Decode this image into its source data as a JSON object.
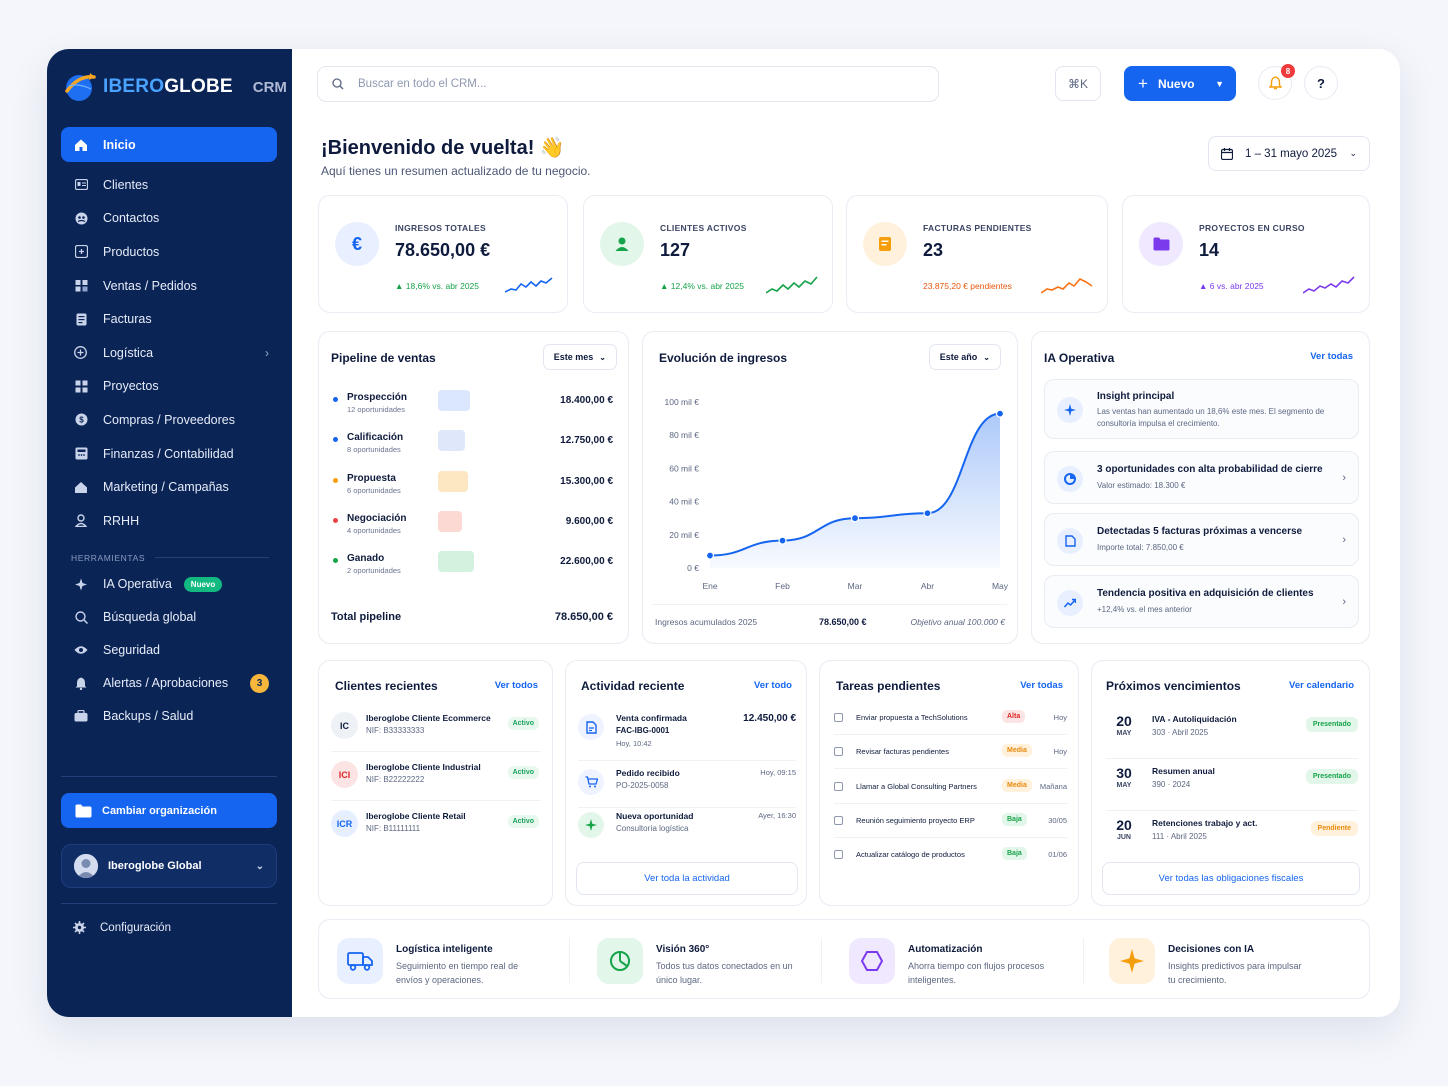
{
  "brand": {
    "name_part1": "IBERO",
    "name_part2": "GLOBE",
    "suffix": "CRM"
  },
  "sidebar": {
    "items": [
      {
        "label": "Inicio",
        "icon": "home-icon"
      },
      {
        "label": "Clientes",
        "icon": "id-card-icon"
      },
      {
        "label": "Contactos",
        "icon": "contacts-icon"
      },
      {
        "label": "Productos",
        "icon": "box-icon"
      },
      {
        "label": "Ventas / Pedidos",
        "icon": "cart-icon"
      },
      {
        "label": "Facturas",
        "icon": "invoice-icon"
      },
      {
        "label": "Logística",
        "icon": "truck-icon"
      },
      {
        "label": "Proyectos",
        "icon": "grid-icon"
      },
      {
        "label": "Compras / Proveedores",
        "icon": "coins-icon"
      },
      {
        "label": "Finanzas / Contabilidad",
        "icon": "calculator-icon"
      },
      {
        "label": "Marketing / Campañas",
        "icon": "megaphone-icon"
      },
      {
        "label": "RRHH",
        "icon": "user-icon"
      }
    ],
    "tools_header": "HERRAMIENTAS",
    "tools": [
      {
        "label": "IA Operativa",
        "badge": "Nuevo"
      },
      {
        "label": "Búsqueda global"
      },
      {
        "label": "Seguridad"
      },
      {
        "label": "Alertas / Aprobaciones",
        "count": "3"
      },
      {
        "label": "Backups / Salud"
      }
    ],
    "org_button": "Cambiar organización",
    "org_name": "Iberoglobe Global",
    "config": "Configuración"
  },
  "topbar": {
    "search_placeholder": "Buscar en todo el CRM...",
    "shortcut": "⌘K",
    "new_button": "Nuevo",
    "notifications": "8",
    "help": "?"
  },
  "header": {
    "welcome": "¡Bienvenido de vuelta! 👋",
    "subtitle": "Aquí tienes un resumen actualizado de tu negocio.",
    "date_range": "1 – 31 mayo 2025"
  },
  "kpis": [
    {
      "label": "INGRESOS TOTALES",
      "value": "78.650,00 €",
      "trend": "▲ 18,6% vs. abr 2025",
      "color": "#16a34a",
      "icon": "euro-icon",
      "accent": "#1565f0"
    },
    {
      "label": "CLIENTES ACTIVOS",
      "value": "127",
      "trend": "▲ 12,4% vs. abr 2025",
      "color": "#16a34a",
      "icon": "user-icon",
      "accent": "#16a34a"
    },
    {
      "label": "FACTURAS PENDIENTES",
      "value": "23",
      "trend": "23.875,20 € pendientes",
      "color": "#ea580c",
      "icon": "invoice-icon",
      "accent": "#f59e0b"
    },
    {
      "label": "PROYECTOS EN CURSO",
      "value": "14",
      "trend": "▲ 6 vs. abr 2025",
      "color": "#7c3aed",
      "icon": "folder-icon",
      "accent": "#7c3aed"
    }
  ],
  "pipeline": {
    "title": "Pipeline de ventas",
    "filter": "Este mes",
    "stages": [
      {
        "name": "Prospección",
        "sub": "12 oportunidades",
        "value": "18.400,00 €",
        "amount": 18400,
        "color": "#1565f0",
        "bar": "#dbe6ff"
      },
      {
        "name": "Calificación",
        "sub": "8 oportunidades",
        "value": "12.750,00 €",
        "amount": 12750,
        "color": "#1565f0",
        "bar": "#dfe8fb"
      },
      {
        "name": "Propuesta",
        "sub": "6 oportunidades",
        "value": "15.300,00 €",
        "amount": 15300,
        "color": "#f59e0b",
        "bar": "#fde7c2"
      },
      {
        "name": "Negociación",
        "sub": "4 oportunidades",
        "value": "9.600,00 €",
        "amount": 9600,
        "color": "#ef4444",
        "bar": "#fdd9d3"
      },
      {
        "name": "Ganado",
        "sub": "2 oportunidades",
        "value": "22.600,00 €",
        "amount": 22600,
        "color": "#16a34a",
        "bar": "#d2f2df"
      }
    ],
    "total_label": "Total pipeline",
    "total_value": "78.650,00 €"
  },
  "revenue": {
    "title": "Evolución de ingresos",
    "filter": "Este año",
    "footer_left": "Ingresos acumulados 2025",
    "footer_mid": "78.650,00 €",
    "footer_right": "Objetivo anual 100.000 €"
  },
  "chart_data": {
    "type": "area",
    "x": [
      "Ene",
      "Feb",
      "Mar",
      "Abr",
      "May"
    ],
    "y_ticks": [
      "100 mil €",
      "80 mil €",
      "60 mil €",
      "40 mil €",
      "20 mil €",
      "0 €"
    ],
    "ylim": [
      0,
      100
    ],
    "series": [
      {
        "values": [
          7.5,
          16.5,
          30,
          33,
          93
        ]
      }
    ],
    "grid": false
  },
  "ai": {
    "title": "IA Operativa",
    "link": "Ver todas",
    "items": [
      {
        "title": "Insight principal",
        "sub": "Las ventas han aumentado un 18,6% este mes. El segmento de consultoría impulsa el crecimiento.",
        "icon": "sparkle-icon"
      },
      {
        "title": "3 oportunidades con alta probabilidad de cierre",
        "sub": "Valor estimado: 18.300 €",
        "icon": "pie-chart-icon"
      },
      {
        "title": "Detectadas 5 facturas próximas a vencerse",
        "sub": "Importe total: 7.850,00 €",
        "icon": "document-icon"
      },
      {
        "title": "Tendencia positiva en adquisición de clientes",
        "sub": "+12,4% vs. el mes anterior",
        "icon": "trend-up-icon"
      }
    ]
  },
  "clients": {
    "title": "Clientes recientes",
    "link": "Ver todos",
    "items": [
      {
        "initials": "IC",
        "name": "Iberoglobe Cliente Ecommerce",
        "nif": "NIF: B33333333",
        "status": "Activo",
        "bg": "#eef1f6",
        "fg": "#0f1b3d"
      },
      {
        "initials": "ICI",
        "name": "Iberoglobe Cliente Industrial",
        "nif": "NIF: B22222222",
        "status": "Activo",
        "bg": "#fde4e4",
        "fg": "#dc2626"
      },
      {
        "initials": "ICR",
        "name": "Iberoglobe Cliente Retail",
        "nif": "NIF: B11111111",
        "status": "Activo",
        "bg": "#e6efff",
        "fg": "#1565f0"
      }
    ]
  },
  "activity": {
    "title": "Actividad reciente",
    "link": "Ver todo",
    "items": [
      {
        "title": "Venta confirmada",
        "sub": "FAC-IBG-0001",
        "sub2": "Hoy, 10:42",
        "right": "12.450,00 €",
        "icon": "receipt-icon"
      },
      {
        "title": "Pedido recibido",
        "sub": "PO-2025-0058",
        "right": "Hoy, 09:15",
        "icon": "cart-icon"
      },
      {
        "title": "Nueva oportunidad",
        "sub": "Consultoría logística",
        "right": "Ayer, 16:30",
        "icon": "sparkle-icon"
      }
    ],
    "button": "Ver toda la actividad"
  },
  "tasks": {
    "title": "Tareas pendientes",
    "link": "Ver todas",
    "items": [
      {
        "name": "Enviar propuesta a TechSolutions",
        "prio": "Alta",
        "date": "Hoy",
        "bg": "#fde4e4",
        "fg": "#dc2626"
      },
      {
        "name": "Revisar facturas pendientes",
        "prio": "Media",
        "date": "Hoy",
        "bg": "#fff1dc",
        "fg": "#ea8a0c"
      },
      {
        "name": "Llamar a Global Consulting Partners",
        "prio": "Media",
        "date": "Mañana",
        "bg": "#fff1dc",
        "fg": "#ea8a0c"
      },
      {
        "name": "Reunión seguimiento proyecto ERP",
        "prio": "Baja",
        "date": "30/05",
        "bg": "#e3f6ea",
        "fg": "#16a34a"
      },
      {
        "name": "Actualizar catálogo de productos",
        "prio": "Baja",
        "date": "01/06",
        "bg": "#e3f6ea",
        "fg": "#16a34a"
      }
    ]
  },
  "deadlines": {
    "title": "Próximos vencimientos",
    "link": "Ver calendario",
    "items": [
      {
        "day": "20",
        "month": "MAY",
        "title": "IVA - Autoliquidación",
        "sub": "303 · Abril 2025",
        "status": "Presentado",
        "bg": "#e3f6ea",
        "fg": "#16a34a"
      },
      {
        "day": "30",
        "month": "MAY",
        "title": "Resumen anual",
        "sub": "390 · 2024",
        "status": "Presentado",
        "bg": "#e3f6ea",
        "fg": "#16a34a"
      },
      {
        "day": "20",
        "month": "JUN",
        "title": "Retenciones trabajo y act.",
        "sub": "111 · Abril 2025",
        "status": "Pendiente",
        "bg": "#fff1dc",
        "fg": "#ea8a0c"
      }
    ],
    "button": "Ver todas las obligaciones fiscales"
  },
  "features": [
    {
      "title": "Logística inteligente",
      "sub": "Seguimiento en tiempo real de envíos y operaciones.",
      "icon": "truck-icon",
      "bg": "#e8efff"
    },
    {
      "title": "Visión 360°",
      "sub": "Todos tus datos conectados en un único lugar.",
      "icon": "pie-chart-icon",
      "bg": "#e3f6ea"
    },
    {
      "title": "Automatización",
      "sub": "Ahorra tiempo con flujos procesos inteligentes.",
      "icon": "hexagon-icon",
      "bg": "#efe8fe"
    },
    {
      "title": "Decisiones con IA",
      "sub": "Insights predictivos para impulsar tu crecimiento.",
      "icon": "sparkle-icon",
      "bg": "#fff1dc"
    }
  ]
}
